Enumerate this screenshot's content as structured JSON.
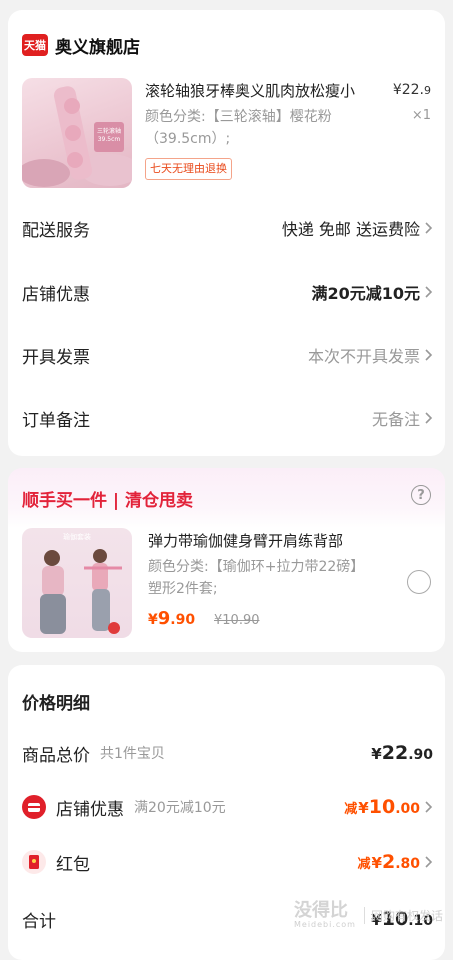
{
  "store": {
    "logo_text": "天猫",
    "name": "奥义旗舰店"
  },
  "product": {
    "thumb_caption_1": "三轮滚轴",
    "thumb_caption_2": "39.5cm",
    "title": "滚轮轴狼牙棒奥义肌肉放松瘦小",
    "spec": "颜色分类:【三轮滚轴】樱花粉（39.5cm）;",
    "price_main": "¥22.",
    "price_decimal": "9",
    "qty": "×1",
    "return_badge": "七天无理由退换"
  },
  "rows": {
    "delivery": {
      "label": "配送服务",
      "value": "快递 免邮 送运费险"
    },
    "store_discount": {
      "label": "店铺优惠",
      "value": "满20元减10元"
    },
    "invoice": {
      "label": "开具发票",
      "value": "本次不开具发票"
    },
    "note": {
      "label": "订单备注",
      "value": "无备注"
    }
  },
  "upsell": {
    "title": "顺手买一件 | 清仓甩卖",
    "help": "?",
    "thumb_caption": "瑜伽套装",
    "name": "弹力带瑜伽健身臂开肩练背部",
    "spec": "颜色分类:【瑜伽环+拉力带22磅】塑形2件套;",
    "price_currency": "¥",
    "price_int": "9",
    "price_dec": ".90",
    "orig_price": "¥10.90"
  },
  "price_detail": {
    "title": "价格明细",
    "total_goods": {
      "label": "商品总价",
      "sub": "共1件宝贝",
      "cur": "¥",
      "int": "22",
      "dec": ".90"
    },
    "store_discount": {
      "label": "店铺优惠",
      "sub": "满20元减10元",
      "pre": "减",
      "cur": "¥",
      "int": "10",
      "dec": ".00"
    },
    "red_packet": {
      "label": "红包",
      "pre": "减",
      "cur": "¥",
      "int": "2",
      "dec": ".80"
    },
    "sum": {
      "label": "合计",
      "cur": "¥",
      "int": "10",
      "dec": ".10"
    }
  },
  "watermark": {
    "main": "没得比",
    "sub": "Meidebi.com",
    "tag": "网购有权发话"
  },
  "colors": {
    "brand_red": "#e02020",
    "price_orange": "#ff5000",
    "upsell_red": "#e2233a"
  }
}
